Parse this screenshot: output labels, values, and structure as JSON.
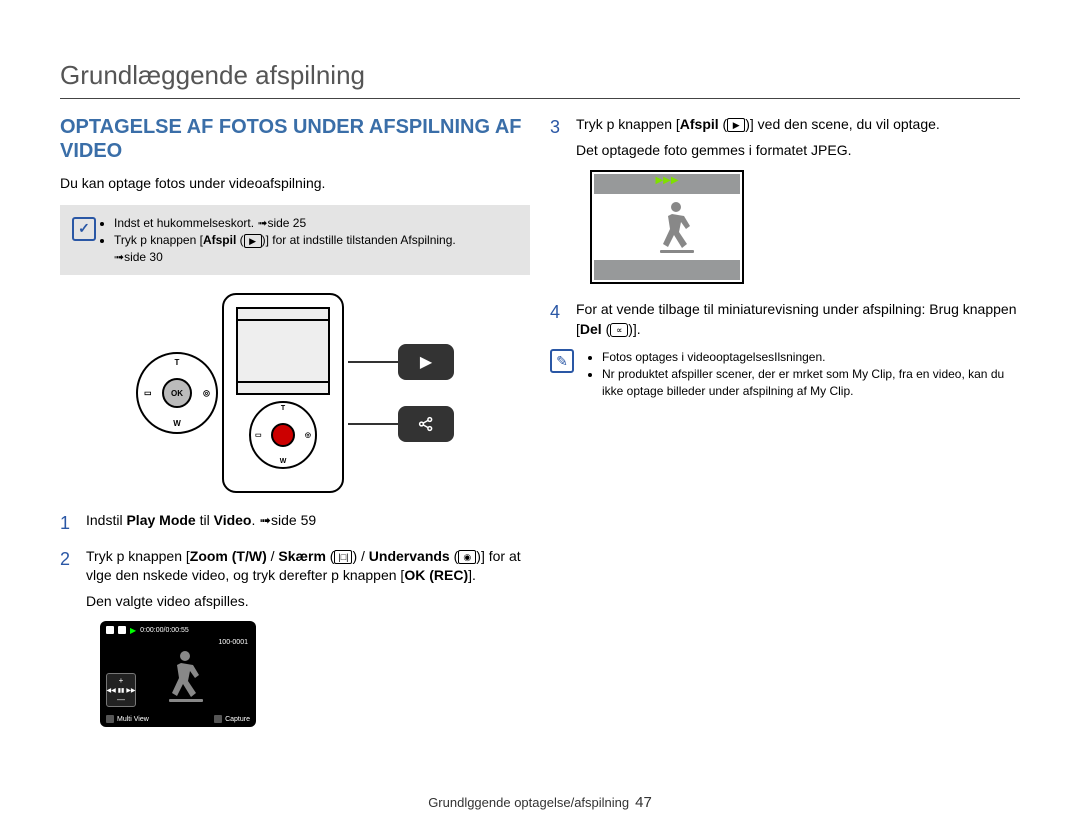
{
  "page": {
    "title": "Grundlæggende afspilning",
    "footer_text": "Grundlggende optagelse/afspilning",
    "page_number": "47"
  },
  "left": {
    "heading": "OPTAGELSE AF FOTOS UNDER AFSPILNING AF VIDEO",
    "intro": "Du kan optage fotos under videoafspilning.",
    "precheck": {
      "item1_a": "Indst et hukommelseskort. ",
      "item1_b": "side 25",
      "item2_a": "Tryk p knappen [",
      "item2_b": "Afspil",
      "item2_c": " (",
      "item2_d": ")] for at indstille tilstanden Afspilning. ",
      "item2_e": "side 30"
    },
    "dpad": {
      "ok": "OK",
      "top": "T",
      "bottom": "W",
      "left": "▭",
      "right": "◎"
    },
    "step1": {
      "num": "1",
      "a": "Indstil ",
      "b": "Play Mode",
      "c": " til ",
      "d": "Video",
      "e": ". ",
      "f": "side 59"
    },
    "step2": {
      "num": "2",
      "a": "Tryk p knappen [",
      "b": "Zoom (T/W)",
      "c": " / ",
      "d": "Skærm",
      "e": " (",
      "f": ") / ",
      "g": "Undervands",
      "h": " (",
      "i": ")] for at vlge den nskede video, og tryk derefter p knappen [",
      "j": "OK (REC)",
      "k": "].",
      "result": "Den valgte video afspilles."
    },
    "playback": {
      "timecode": "0:00:00/0:00:55",
      "counter": "100-0001",
      "plus": "+",
      "minus": "—",
      "multi_view": "Multi View",
      "capture": "Capture"
    }
  },
  "right": {
    "step3": {
      "num": "3",
      "a": "Tryk p knappen [",
      "b": "Afspil",
      "c": " (",
      "d": ")] ved den scene, du vil optage.",
      "result": "Det optagede foto gemmes i formatet JPEG."
    },
    "photo": {
      "ff": "▶▶▶"
    },
    "step4": {
      "num": "4",
      "a": "For at vende tilbage til miniaturevisning under afspilning: Brug knappen [",
      "b": "Del",
      "c": " (",
      "d": ")]."
    },
    "note": {
      "item1": "Fotos optages i videooptagelsesIlsningen.",
      "item2": "Nr produktet afspiller scener, der er mrket som My Clip, fra en video, kan du ikke optage billeder under afspilning af My Clip."
    }
  }
}
